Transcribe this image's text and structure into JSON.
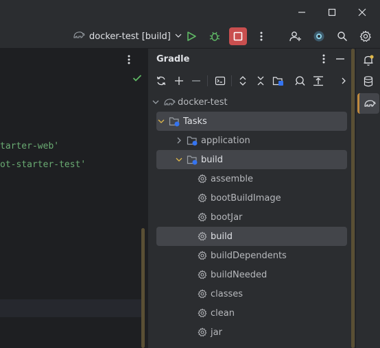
{
  "toolbar": {
    "run_config": "docker-test [build]",
    "icons": [
      "gradle-elephant-icon",
      "chevron-down-icon",
      "run-icon",
      "debug-icon",
      "stop-icon",
      "more-vertical-icon",
      "add-user-icon",
      "ai-assistant-icon",
      "search-icon",
      "settings-icon"
    ],
    "accent_stop": "#c94f4f",
    "accent_run": "#5fb865"
  },
  "editor": {
    "code_lines": [
      "tarter-web'",
      "ot-starter-test'"
    ]
  },
  "gradle": {
    "title": "Gradle",
    "tree": {
      "root": "docker-test",
      "tasks": "Tasks",
      "application": "application",
      "build_group": "build",
      "items": [
        "assemble",
        "bootBuildImage",
        "bootJar",
        "build",
        "buildDependents",
        "buildNeeded",
        "classes",
        "clean",
        "jar"
      ]
    }
  },
  "colors": {
    "selection": "#43454a",
    "scrollbar": "#5a4f34",
    "code_string": "#6aab73"
  }
}
